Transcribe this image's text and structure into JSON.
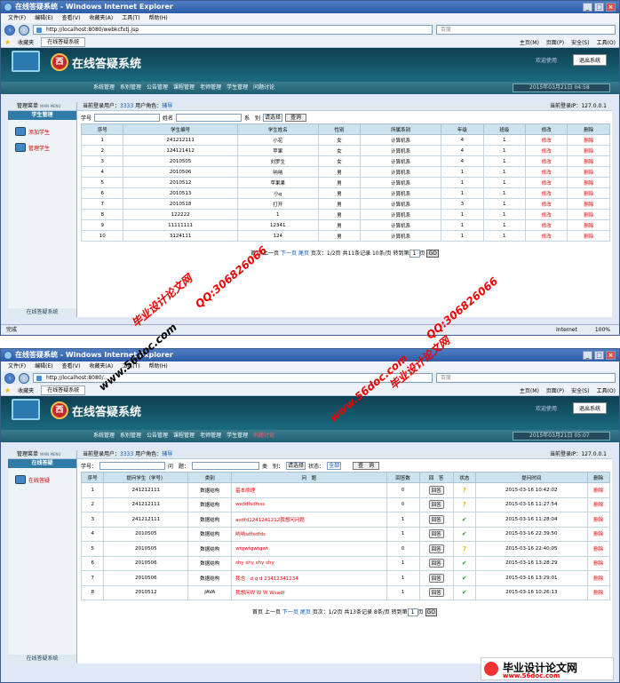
{
  "browser": {
    "title1": "在线答疑系统 - Windows Internet Explorer",
    "title2": "在线答疑系统 - Windows Internet Explorer",
    "menu": [
      "文件(F)",
      "编辑(E)",
      "查看(V)",
      "收藏夹(A)",
      "工具(T)",
      "帮助(H)"
    ],
    "url1": "http://localhost:8080/webkcfxtj.jsp",
    "url2": "http://localhost:8080/...",
    "search_placeholder": "百度",
    "favorites": "收藏夹",
    "tab_label": "在线答疑系统",
    "tools": [
      "主页(M)",
      "页面(P)",
      "安全(S)",
      "工具(O)"
    ],
    "status_left": "完成",
    "status_zone": "Internet",
    "zoom": "100%"
  },
  "app": {
    "title": "在线答疑系统",
    "logo_char": "西",
    "exit": "退出系统",
    "banner_hint": "欢迎使用",
    "nav": [
      "系统管理",
      "系别管理",
      "公告管理",
      "课程管理",
      "老师管理",
      "学生管理",
      "问题讨论"
    ],
    "date1": "2015年03月21日 04:58",
    "date2": "2015年03月21日 05:07",
    "sidebar_head": "管理菜单",
    "sidebar_head_small": "MAIN MENU",
    "sidebar_footer": "在线答疑系统",
    "user_label": "当前登录用户：",
    "user": "3333",
    "role_label": "用户角色：",
    "role": "辅导",
    "ip_label": "当前登录IP：",
    "ip": "127.0.0.1"
  },
  "s1": {
    "menu_title": "学生管理",
    "links": [
      "添加学生",
      "管理学生"
    ],
    "labels": {
      "num": "学号",
      "name": "姓名",
      "dept": "系　别",
      "sel": "请选择",
      "query": "查询"
    },
    "headers": [
      "序号",
      "学生编号",
      "学生姓名",
      "性别",
      "所属系别",
      "年级",
      "班级",
      "修改",
      "删除"
    ],
    "rows": [
      [
        "1",
        "241212111",
        "小花",
        "女",
        "计算机系",
        "4",
        "1",
        "修改",
        "删除"
      ],
      [
        "2",
        "124121412",
        "苹果",
        "女",
        "计算机系",
        "4",
        "1",
        "修改",
        "删除"
      ],
      [
        "3",
        "2010505",
        "刘罗生",
        "女",
        "计算机系",
        "4",
        "1",
        "修改",
        "删除"
      ],
      [
        "4",
        "2010506",
        "呐呐",
        "男",
        "计算机系",
        "1",
        "1",
        "修改",
        "删除"
      ],
      [
        "5",
        "2010512",
        "苹果果",
        "男",
        "计算机系",
        "1",
        "1",
        "修改",
        "删除"
      ],
      [
        "6",
        "2010513",
        "小q",
        "男",
        "计算机系",
        "1",
        "1",
        "修改",
        "删除"
      ],
      [
        "7",
        "2010518",
        "打开",
        "男",
        "计算机系",
        "3",
        "1",
        "修改",
        "删除"
      ],
      [
        "8",
        "122222",
        "1",
        "男",
        "计算机系",
        "1",
        "1",
        "修改",
        "删除"
      ],
      [
        "9",
        "11111111",
        "12341",
        "男",
        "计算机系",
        "1",
        "1",
        "修改",
        "删除"
      ],
      [
        "10",
        "3124111",
        "124",
        "男",
        "计算机系",
        "1",
        "1",
        "修改",
        "删除"
      ]
    ],
    "pager": {
      "first": "首页",
      "prev": "上一页",
      "next": "下一页",
      "last": "尾页",
      "info": "页次：1/2页 共11条记录 10条/页 转到第",
      "page": "1",
      "tail": "页",
      "go": "GO"
    }
  },
  "s2": {
    "menu_title": "在线答疑",
    "links": [
      "在线答疑"
    ],
    "labels": {
      "num": "学号：",
      "title": "问　题：",
      "type": "类　别：",
      "sel": "请选择",
      "status": "状态：",
      "all": "全部",
      "query": "查　询"
    },
    "headers": [
      "序号",
      "提问学生（学号）",
      "类别",
      "问　题",
      "回答数",
      "回　答",
      "状态",
      "提问时间",
      "删除"
    ],
    "rows": [
      [
        "1",
        "241212111",
        "数据结构",
        "基本原理",
        "0",
        "回答",
        "q",
        "2015-03-16 10:42:02",
        "删除"
      ],
      [
        "2",
        "241212111",
        "数据结构",
        "wsddfsdfsss",
        "0",
        "回答",
        "q",
        "2015-03-16 11:27:54",
        "删除"
      ],
      [
        "3",
        "241212111",
        "数据结构",
        "asdfd1241241212我想问问题",
        "1",
        "回答",
        "ok",
        "2015-03-16 11:28:04",
        "删除"
      ],
      [
        "4",
        "2010505",
        "数据结构",
        "呐呐sdfsdfds",
        "1",
        "回答",
        "ok",
        "2015-03-16 22:39:50",
        "删除"
      ],
      [
        "5",
        "2010505",
        "数据结构",
        "wtgwtgwtgwt",
        "0",
        "回答",
        "q",
        "2015-03-16 22:40:05",
        "删除"
      ],
      [
        "6",
        "2010506",
        "数据结构",
        "shy shy shy shy",
        "1",
        "回答",
        "ok",
        "2015-03-16 13:28:29",
        "删除"
      ],
      [
        "7",
        "2010506",
        "数据结构",
        "我也　d q d 23412341234",
        "1",
        "回答",
        "ok",
        "2015-03-16 13:29:01",
        "删除"
      ],
      [
        "8",
        "2010512",
        "JAVA",
        "我想问Ｗ Ｗ Ｗ Wsadf",
        "1",
        "回答",
        "ok",
        "2015-03-16 10:26:13",
        "删除"
      ]
    ],
    "pager": {
      "first": "首页",
      "prev": "上一页",
      "next": "下一页",
      "last": "尾页",
      "info": "页次：1/2页 共13条记录 8条/页 转到第",
      "page": "1",
      "tail": "页",
      "go": "GO"
    }
  },
  "watermarks": [
    "毕业设计论文网",
    "QQ:306826066",
    "www.56doc.com"
  ],
  "footer_logo": {
    "title": "毕业设计论文网",
    "url": "www.56doc.com"
  }
}
